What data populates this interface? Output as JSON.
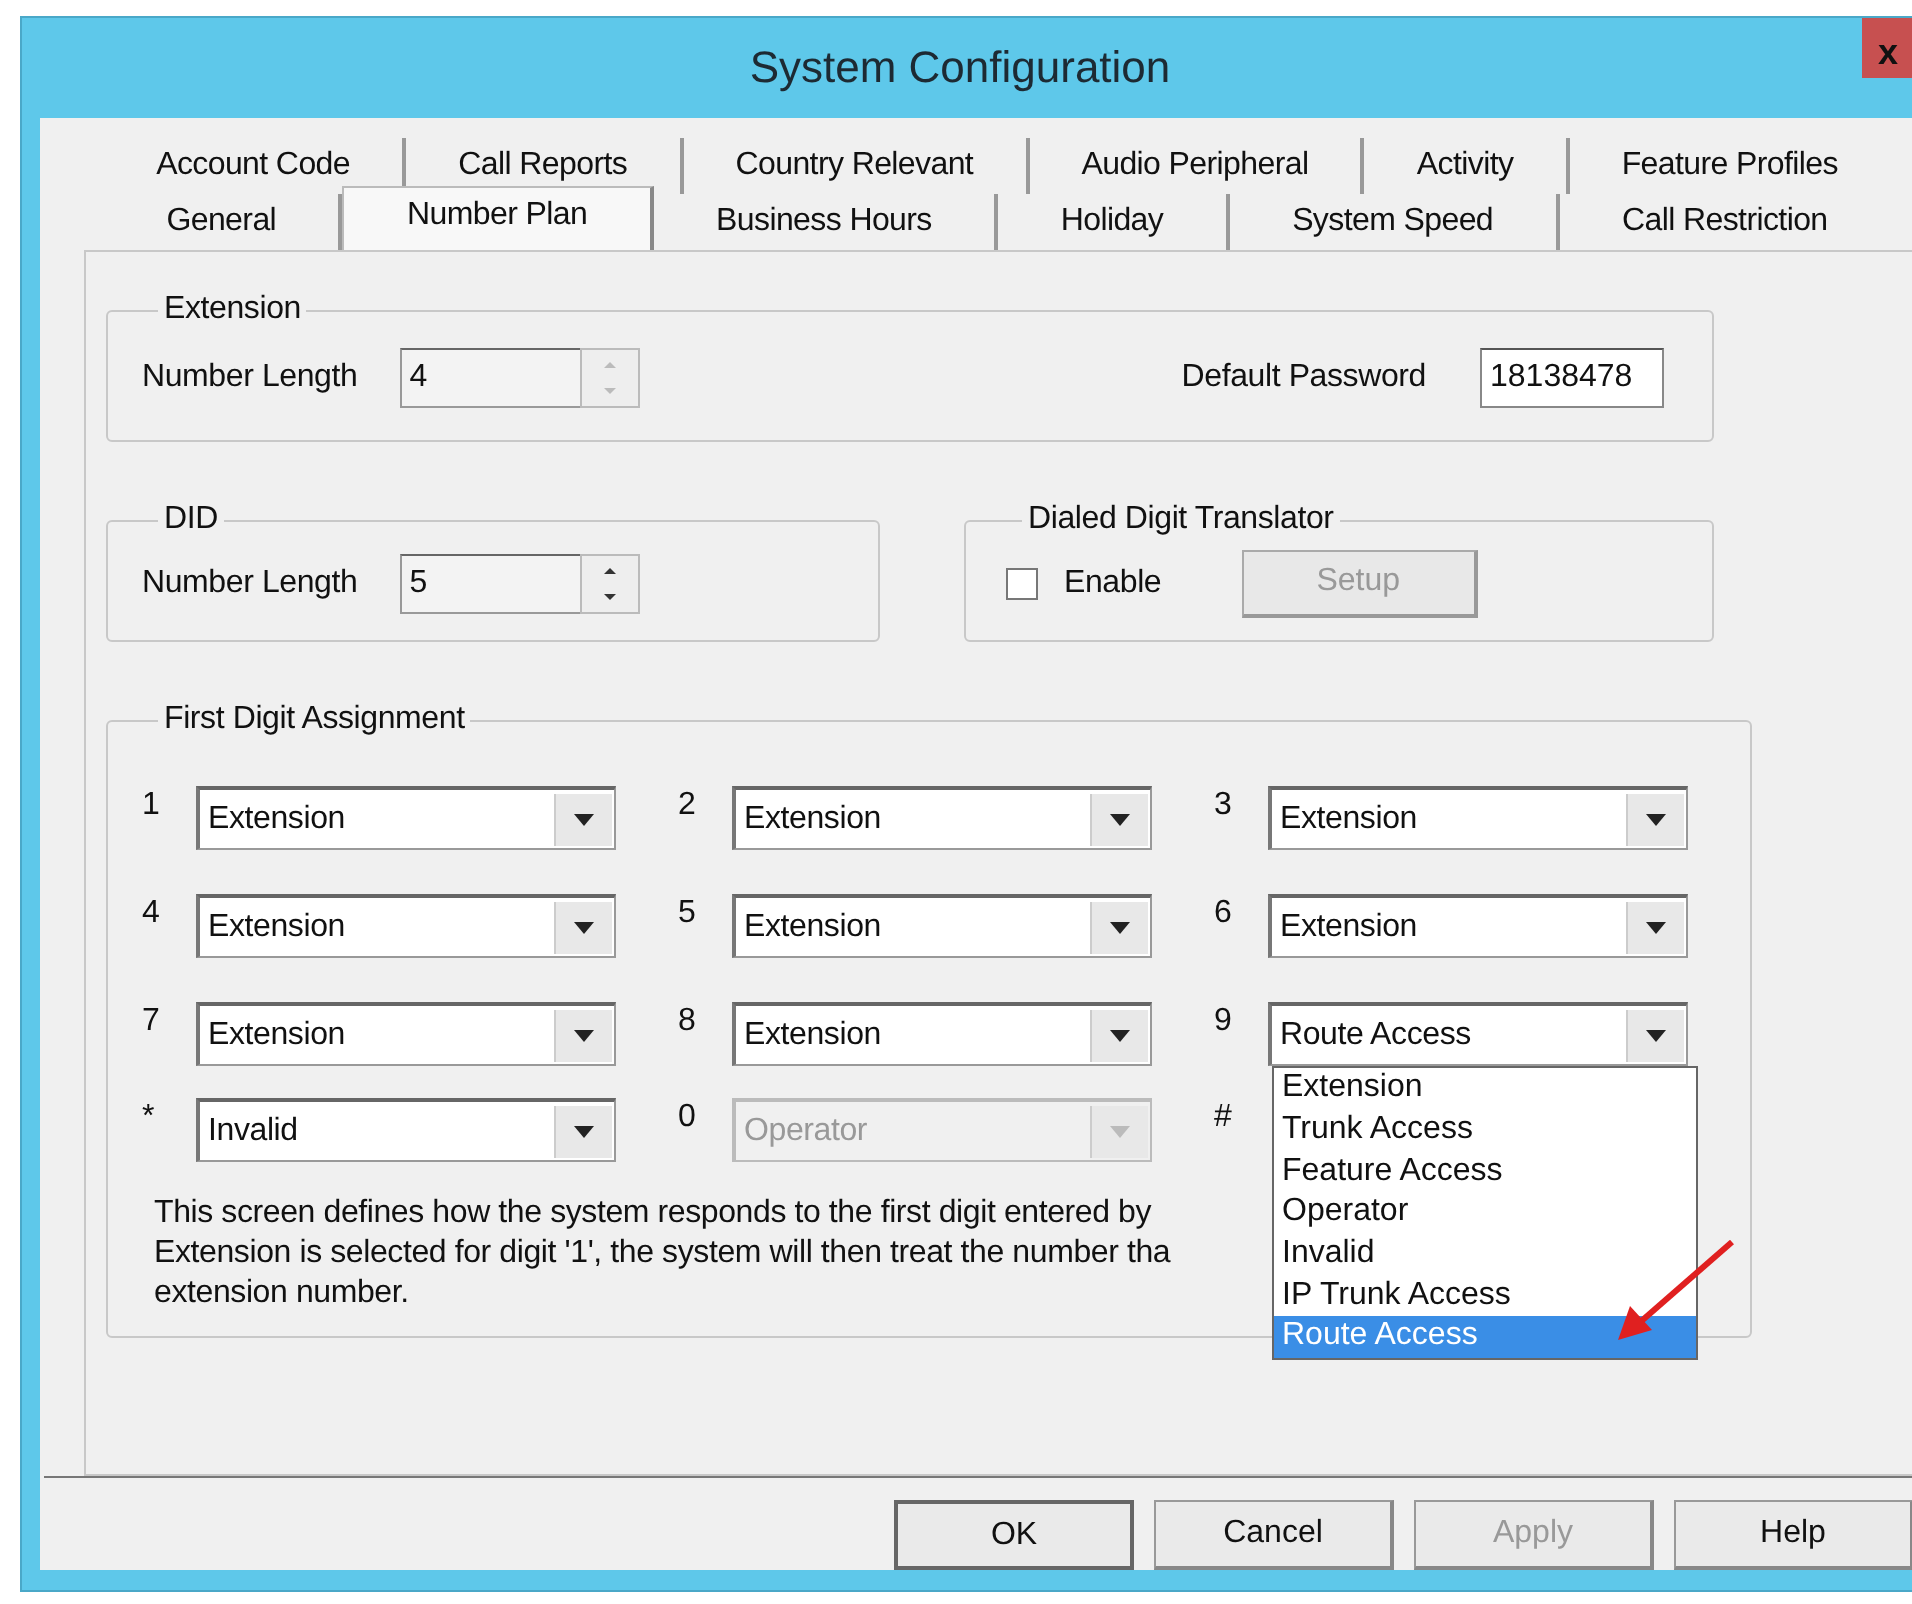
{
  "window": {
    "title": "System Configuration",
    "close_label": "x"
  },
  "tabs": {
    "rows": [
      [
        {
          "label": "Account Code",
          "selected": false
        },
        {
          "label": "Call Reports",
          "selected": false
        },
        {
          "label": "Country Relevant",
          "selected": false
        },
        {
          "label": "Audio Peripheral",
          "selected": false
        },
        {
          "label": "Activity",
          "selected": false
        },
        {
          "label": "Feature Profiles",
          "selected": false
        }
      ],
      [
        {
          "label": "General",
          "selected": false
        },
        {
          "label": "Number Plan",
          "selected": true
        },
        {
          "label": "Business Hours",
          "selected": false
        },
        {
          "label": "Holiday",
          "selected": false
        },
        {
          "label": "System Speed",
          "selected": false
        },
        {
          "label": "Call Restriction",
          "selected": false
        }
      ]
    ]
  },
  "extension": {
    "title": "Extension",
    "number_length_label": "Number Length",
    "number_length": "4",
    "spinner_disabled": true,
    "default_password_label": "Default Password",
    "default_password": "18138478"
  },
  "did": {
    "title": "DID",
    "number_length_label": "Number Length",
    "number_length": "5",
    "spinner_disabled": false
  },
  "translator": {
    "title": "Dialed Digit Translator",
    "enable_label": "Enable",
    "enable_checked": false,
    "setup_label": "Setup",
    "setup_disabled": true
  },
  "first_digit": {
    "title": "First Digit Assignment",
    "assignments": [
      {
        "digit": "1",
        "value": "Extension",
        "disabled": false
      },
      {
        "digit": "2",
        "value": "Extension",
        "disabled": false
      },
      {
        "digit": "3",
        "value": "Extension",
        "disabled": false
      },
      {
        "digit": "4",
        "value": "Extension",
        "disabled": false
      },
      {
        "digit": "5",
        "value": "Extension",
        "disabled": false
      },
      {
        "digit": "6",
        "value": "Extension",
        "disabled": false
      },
      {
        "digit": "7",
        "value": "Extension",
        "disabled": false
      },
      {
        "digit": "8",
        "value": "Extension",
        "disabled": false
      },
      {
        "digit": "9",
        "value": "Route Access",
        "disabled": false,
        "options": [
          {
            "label": "Extension",
            "selected": false
          },
          {
            "label": "Trunk Access",
            "selected": false
          },
          {
            "label": "Feature Access",
            "selected": false
          },
          {
            "label": "Operator",
            "selected": false
          },
          {
            "label": "Invalid",
            "selected": false
          },
          {
            "label": "IP Trunk Access",
            "selected": false
          },
          {
            "label": "Route Access",
            "selected": true
          }
        ]
      },
      {
        "digit": "*",
        "value": "Invalid",
        "disabled": false
      },
      {
        "digit": "0",
        "value": "Operator",
        "disabled": true
      },
      {
        "digit": "#"
      }
    ],
    "description_lines": [
      "This screen defines how the system responds to the first digit entered by",
      "Extension is selected for digit '1', the system will then treat the number tha",
      "extension number."
    ]
  },
  "buttons": [
    {
      "label": "OK",
      "disabled": false,
      "default": true
    },
    {
      "label": "Cancel",
      "disabled": false,
      "default": false
    },
    {
      "label": "Apply",
      "disabled": true,
      "default": false
    },
    {
      "label": "Help",
      "disabled": false,
      "default": false
    }
  ]
}
